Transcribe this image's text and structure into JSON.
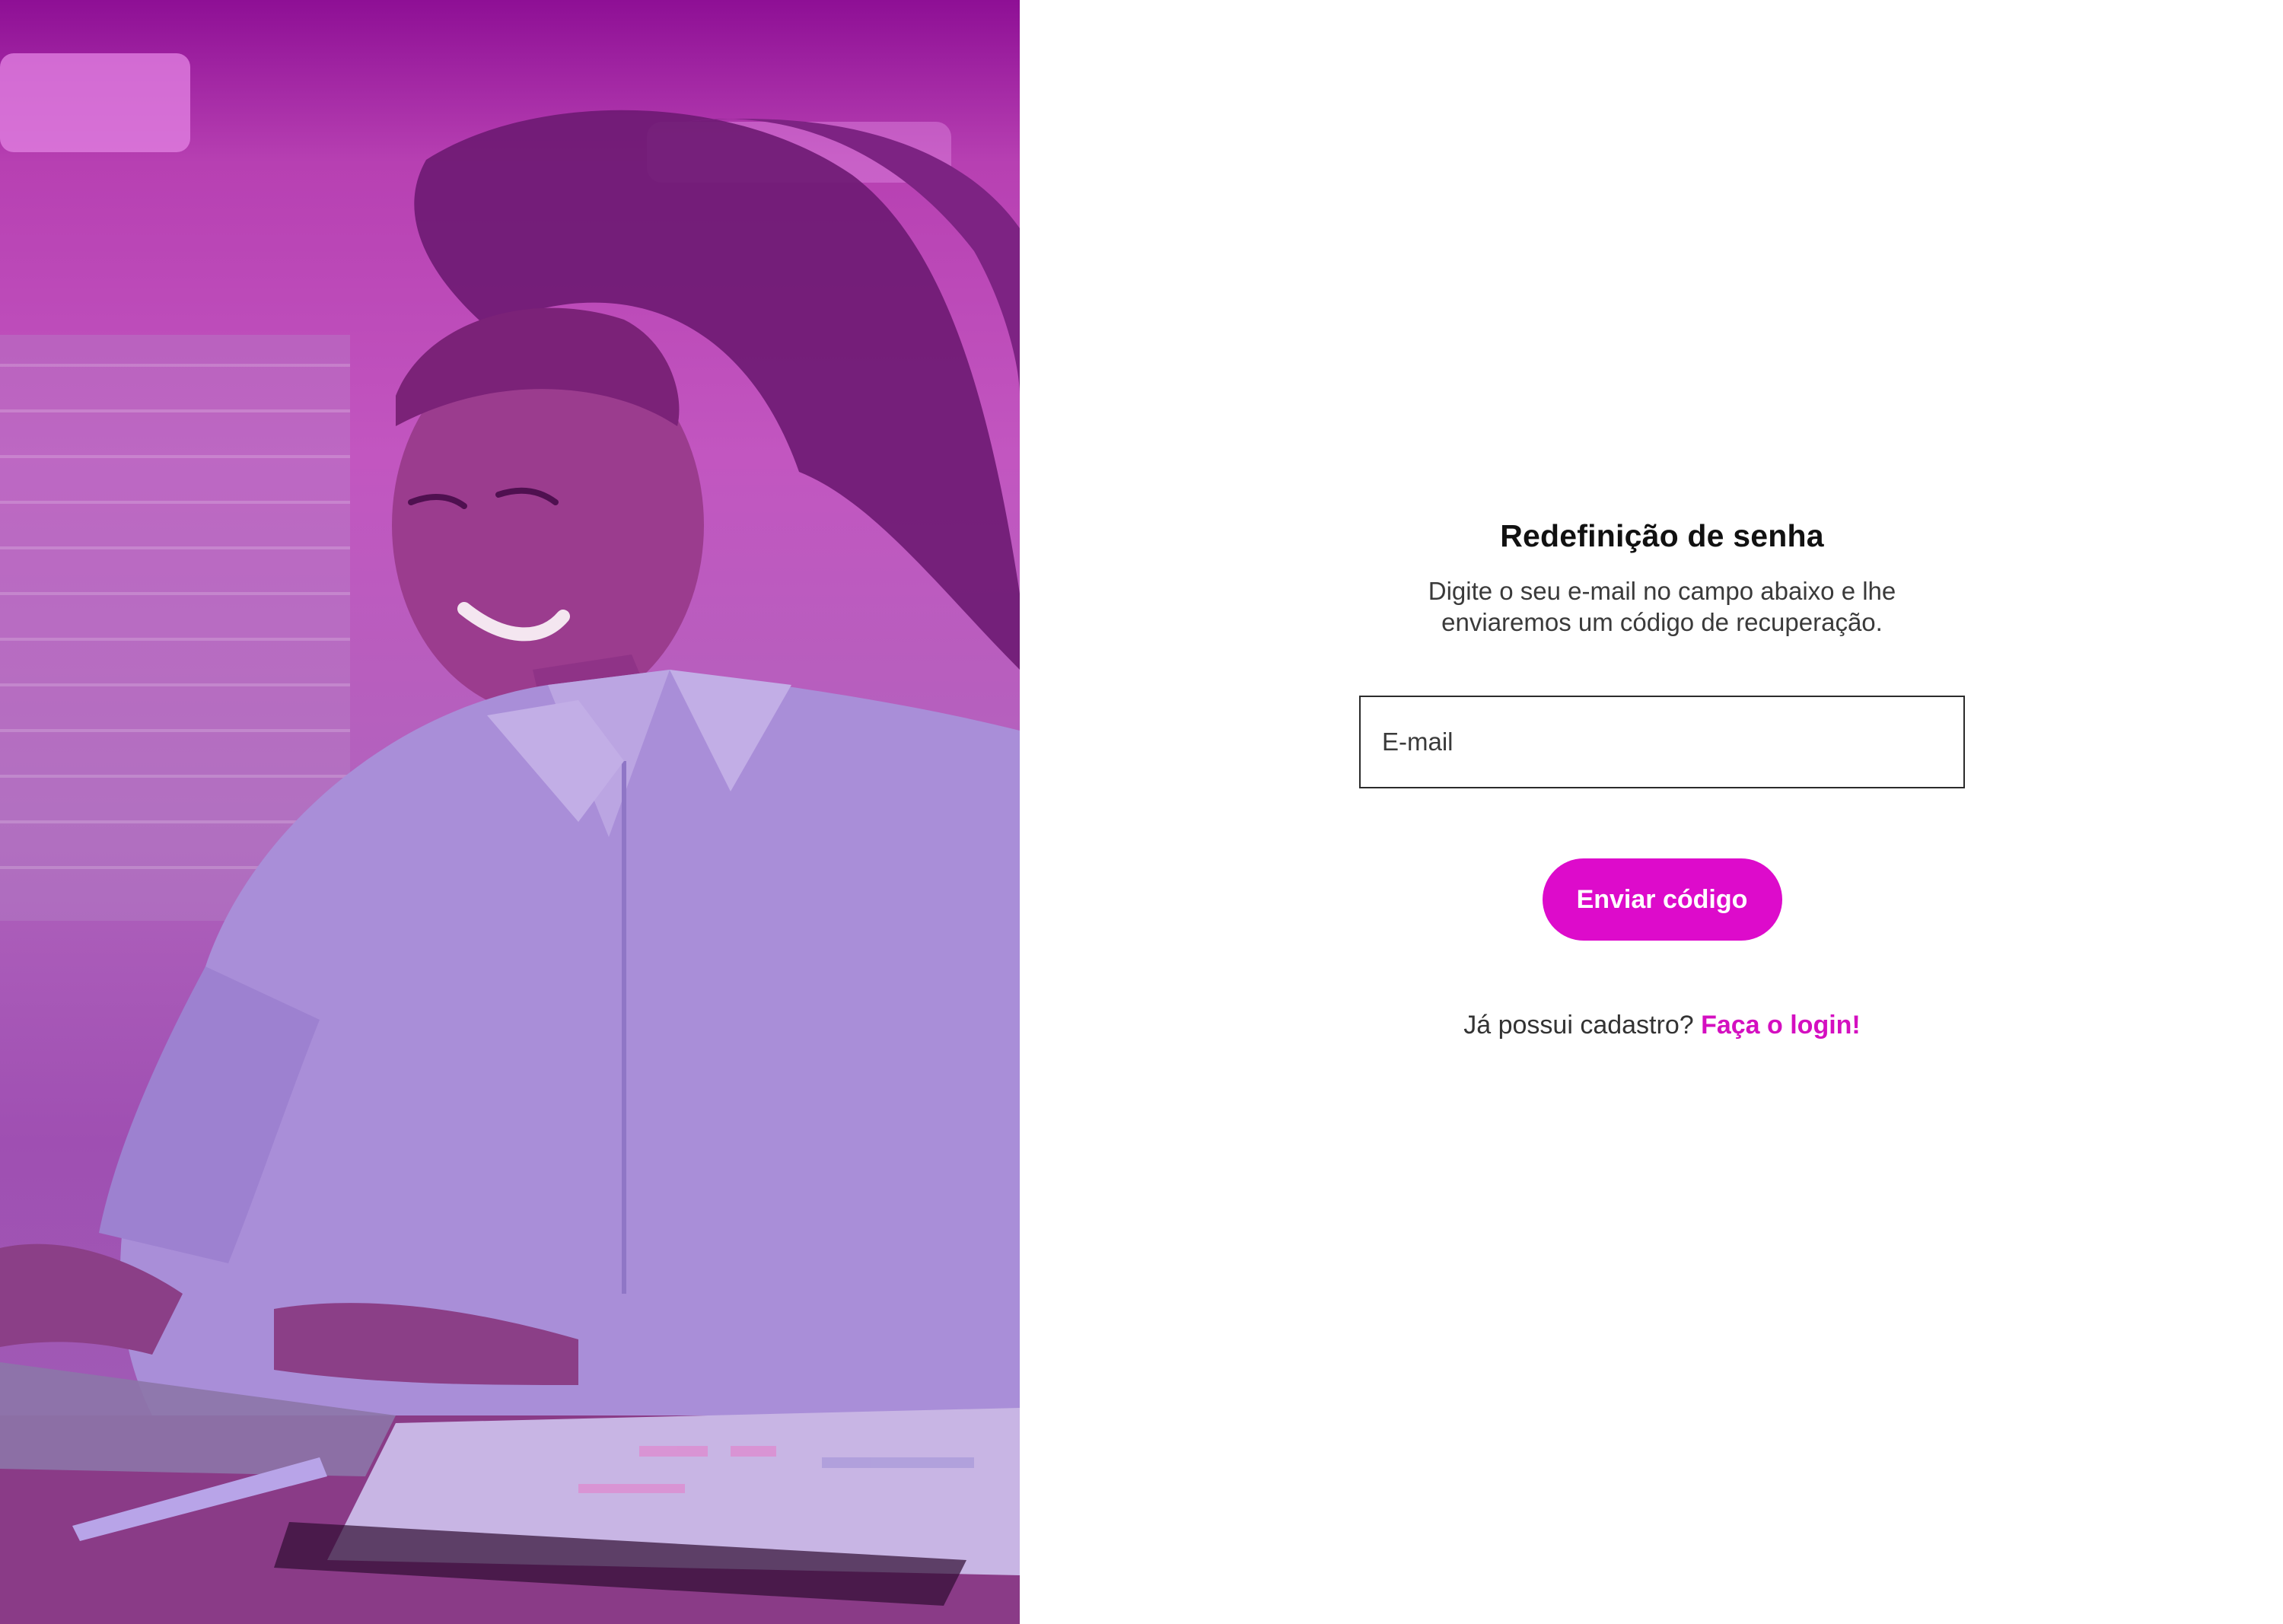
{
  "hero": {
    "image": "woman-typing-on-laptop",
    "overlay_color": "#c24fbf"
  },
  "form": {
    "title": "Redefinição de senha",
    "subtitle": "Digite o seu e-mail no campo abaixo e lhe enviaremos um código de recuperação.",
    "email_placeholder": "E-mail",
    "submit_label": "Enviar código",
    "login_prompt": "Já possui cadastro?",
    "login_link": "Faça o login!"
  },
  "colors": {
    "accent": "#dd0bcb",
    "link": "#d40fc0",
    "text": "#111111"
  }
}
